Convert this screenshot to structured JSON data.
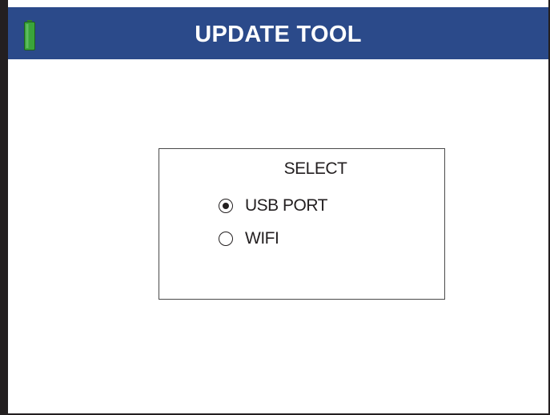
{
  "header": {
    "title": "UPDATE TOOL",
    "battery_icon": "battery-full-icon",
    "background_color": "#2b4a8a",
    "battery_color": "#3aa53a"
  },
  "dialog": {
    "heading": "SELECT",
    "options": [
      {
        "label": "USB PORT",
        "selected": true
      },
      {
        "label": "WIFI",
        "selected": false
      }
    ]
  }
}
